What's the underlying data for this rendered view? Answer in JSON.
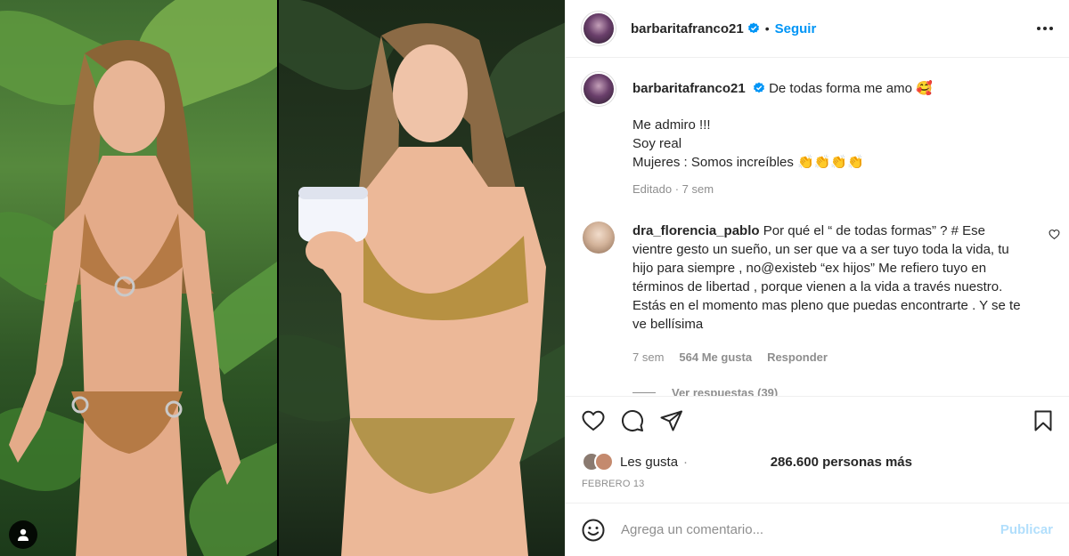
{
  "post": {
    "username": "barbaritafranco21",
    "verified": true,
    "follow_label": "Seguir"
  },
  "caption": {
    "username": "barbaritafranco21",
    "text": "De todas forma me amo 🥰",
    "lines": [
      "Me admiro !!!",
      "Soy real",
      "Mujeres : Somos increíbles 👏👏👏👏"
    ],
    "edited": "Editado",
    "time": "7 sem"
  },
  "comment": {
    "username": "dra_florencia_pablo",
    "text": "Por qué el “ de todas formas” ? # Ese vientre gesto un sueño, un ser que va a ser tuyo toda la vida, tu hijo para siempre , no@existeb “ex hijos” Me refiero tuyo en términos de libertad , porque vienen a la vida a través nuestro. Estás en el momento mas pleno que puedas encontrarte . Y se te ve bellísima",
    "time": "7 sem",
    "likes": "564 Me gusta",
    "reply_label": "Responder",
    "view_replies": "Ver respuestas (39)"
  },
  "likes": {
    "prefix": "Les gusta",
    "mid": "·",
    "count": "286.600 personas más"
  },
  "date": "FEBRERO 13",
  "add_comment": {
    "placeholder": "Agrega un comentario...",
    "publish_label": "Publicar"
  },
  "icons": {
    "like": "heart-icon",
    "comment": "comment-icon",
    "share": "share-icon",
    "save": "bookmark-icon",
    "emoji": "emoji-icon",
    "more": "more-icon",
    "tag": "user-tag-icon"
  },
  "colors": {
    "accent": "#0095f6",
    "publish_disabled": "#b2dffc",
    "muted": "#8e8e8e",
    "text": "#262626",
    "verified": "#0095f6"
  }
}
